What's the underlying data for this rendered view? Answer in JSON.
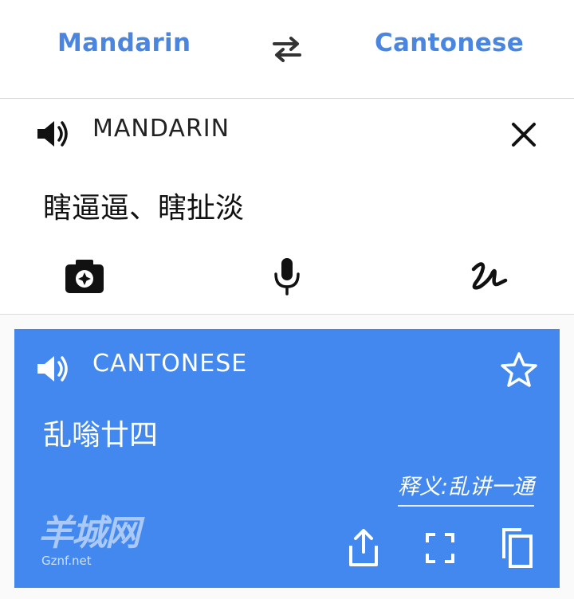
{
  "colors": {
    "accent": "#4a86e0",
    "blue": "#4388ee"
  },
  "header": {
    "source_lang": "Mandarin",
    "target_lang": "Cantonese",
    "swap_icon": "swap-arrows-icon"
  },
  "input": {
    "label": "MANDARIN",
    "text": "瞎逼逼、瞎扯淡",
    "icons": [
      "speaker-icon",
      "close-icon",
      "camera-icon",
      "mic-icon",
      "handwriting-icon"
    ]
  },
  "output": {
    "label": "CANTONESE",
    "text": "乱嗡廿四",
    "note": "释义:乱讲一通",
    "icons": [
      "speaker-icon",
      "star-icon",
      "share-icon",
      "fullscreen-icon",
      "copy-icon"
    ]
  },
  "watermark": {
    "text": "羊城网",
    "url": "Gznf.net"
  }
}
